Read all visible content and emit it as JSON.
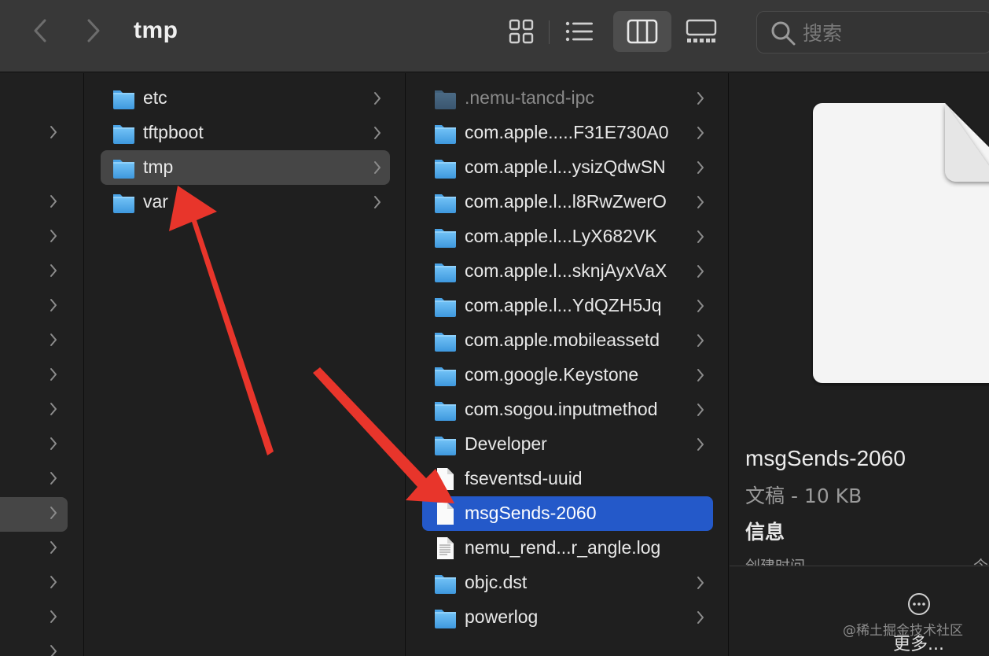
{
  "window": {
    "title": "tmp"
  },
  "toolbar": {
    "back_icon": "chevron-left-icon",
    "forward_icon": "chevron-right-icon",
    "views": [
      {
        "name": "icon-view",
        "icon": "grid-icon",
        "active": false
      },
      {
        "name": "list-view",
        "icon": "list-icon",
        "active": false
      },
      {
        "name": "column-view",
        "icon": "columns-icon",
        "active": true
      },
      {
        "name": "gallery-view",
        "icon": "gallery-icon",
        "active": false
      }
    ],
    "search_placeholder": "搜索"
  },
  "column2": {
    "items": [
      {
        "label": "etc",
        "type": "folder",
        "has_children": true
      },
      {
        "label": "tftpboot",
        "type": "folder",
        "has_children": true
      },
      {
        "label": "tmp",
        "type": "folder",
        "has_children": true,
        "selected": true
      },
      {
        "label": "var",
        "type": "folder",
        "has_children": true
      }
    ]
  },
  "column3": {
    "items": [
      {
        "label": ".nemu-tancd-ipc",
        "type": "folder",
        "dim": true,
        "has_children": true
      },
      {
        "label": "com.apple.....F31E730A0",
        "type": "folder",
        "has_children": true
      },
      {
        "label": "com.apple.l...ysizQdwSN",
        "type": "folder",
        "has_children": true
      },
      {
        "label": "com.apple.l...l8RwZwerO",
        "type": "folder",
        "has_children": true
      },
      {
        "label": "com.apple.l...LyX682VK",
        "type": "folder",
        "has_children": true
      },
      {
        "label": "com.apple.l...sknjAyxVaX",
        "type": "folder",
        "has_children": true
      },
      {
        "label": "com.apple.l...YdQZH5Jq",
        "type": "folder",
        "has_children": true
      },
      {
        "label": "com.apple.mobileassetd",
        "type": "folder",
        "has_children": true
      },
      {
        "label": "com.google.Keystone",
        "type": "folder",
        "has_children": true
      },
      {
        "label": "com.sogou.inputmethod",
        "type": "folder",
        "has_children": true
      },
      {
        "label": "Developer",
        "type": "folder",
        "has_children": true
      },
      {
        "label": "fseventsd-uuid",
        "type": "file",
        "has_children": false
      },
      {
        "label": "msgSends-2060",
        "type": "file",
        "has_children": false,
        "selected": true
      },
      {
        "label": "nemu_rend...r_angle.log",
        "type": "textfile",
        "has_children": false
      },
      {
        "label": "objc.dst",
        "type": "folder",
        "has_children": true
      },
      {
        "label": "powerlog",
        "type": "folder",
        "has_children": true
      }
    ]
  },
  "preview": {
    "file_name": "msgSends-2060",
    "kind_size": "文稿 - 10 KB",
    "info_heading": "信息",
    "created_label": "创建时间",
    "created_value": "今",
    "more_label": "更多...",
    "more_icon": "ellipsis-circle-icon"
  },
  "watermark": "@稀土掘金技术社区",
  "colors": {
    "toolbar_bg": "#383838",
    "selection_blue": "#2459c9",
    "selection_grey": "#464646",
    "folder_blue": "#5ab0ee",
    "arrow_red": "#e8352b"
  }
}
